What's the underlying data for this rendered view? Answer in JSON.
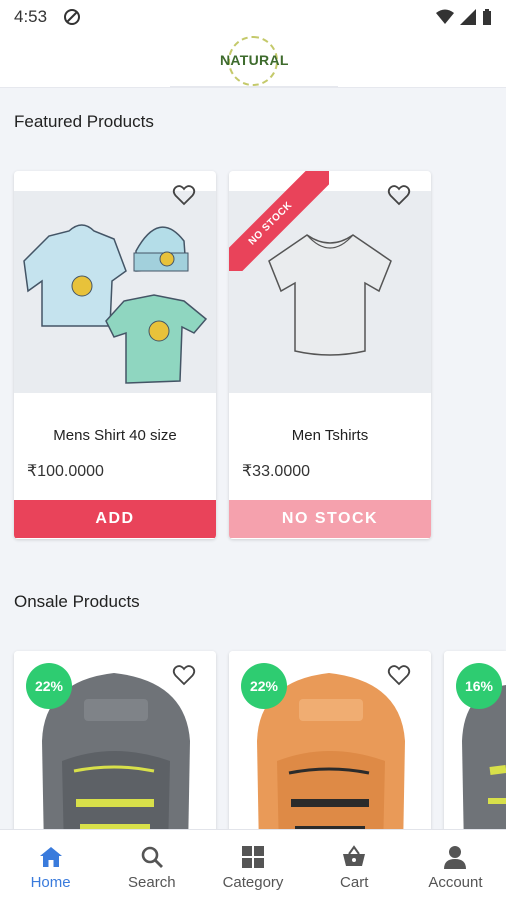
{
  "status_bar": {
    "time": "4:53"
  },
  "header": {
    "logo_text": "NATURAL"
  },
  "featured": {
    "title": "Featured Products",
    "products": [
      {
        "name": "Mens Shirt 40 size",
        "price": "₹100.0000",
        "button": "ADD",
        "ribbon": ""
      },
      {
        "name": "Men Tshirts",
        "price": "₹33.0000",
        "button": "NO STOCK",
        "ribbon": "NO STOCK"
      }
    ]
  },
  "onsale": {
    "title": "Onsale Products",
    "products": [
      {
        "discount": "22%"
      },
      {
        "discount": "22%"
      },
      {
        "discount": "16%"
      }
    ]
  },
  "bottom_nav": [
    {
      "label": "Home",
      "icon": "home-icon",
      "active": true
    },
    {
      "label": "Search",
      "icon": "search-icon",
      "active": false
    },
    {
      "label": "Category",
      "icon": "grid-icon",
      "active": false
    },
    {
      "label": "Cart",
      "icon": "basket-icon",
      "active": false
    },
    {
      "label": "Account",
      "icon": "person-icon",
      "active": false
    }
  ],
  "colors": {
    "accent": "#e9435a",
    "accent_light": "#f5a1ad",
    "badge": "#2ecc71",
    "nav_active": "#3a7bdc"
  }
}
